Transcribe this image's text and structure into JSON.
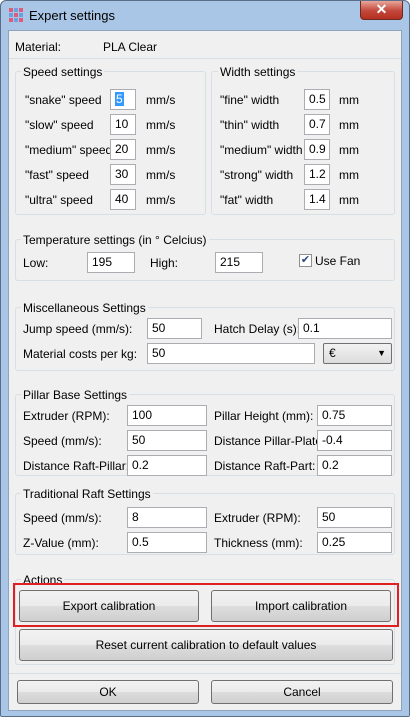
{
  "window": {
    "title": "Expert settings",
    "close_label": "✕"
  },
  "material": {
    "label": "Material:",
    "value": "PLA Clear"
  },
  "speed": {
    "title": "Speed settings",
    "rows": [
      {
        "label": "\"snake\" speed",
        "value": "5",
        "unit": "mm/s"
      },
      {
        "label": "\"slow\" speed",
        "value": "10",
        "unit": "mm/s"
      },
      {
        "label": "\"medium\" speed",
        "value": "20",
        "unit": "mm/s"
      },
      {
        "label": "\"fast\" speed",
        "value": "30",
        "unit": "mm/s"
      },
      {
        "label": "\"ultra\" speed",
        "value": "40",
        "unit": "mm/s"
      }
    ]
  },
  "width": {
    "title": "Width settings",
    "rows": [
      {
        "label": "\"fine\" width",
        "value": "0.5",
        "unit": "mm"
      },
      {
        "label": "\"thin\" width",
        "value": "0.7",
        "unit": "mm"
      },
      {
        "label": "\"medium\" width",
        "value": "0.9",
        "unit": "mm"
      },
      {
        "label": "\"strong\" width",
        "value": "1.2",
        "unit": "mm"
      },
      {
        "label": "\"fat\" width",
        "value": "1.4",
        "unit": "mm"
      }
    ]
  },
  "temperature": {
    "title": "Temperature settings (in ° Celcius)",
    "low_label": "Low:",
    "low_value": "195",
    "high_label": "High:",
    "high_value": "215",
    "fan_label": "Use Fan",
    "fan_checked": true
  },
  "misc": {
    "title": "Miscellaneous Settings",
    "jump_label": "Jump speed (mm/s):",
    "jump_value": "50",
    "hatch_label": "Hatch Delay (s):",
    "hatch_value": "0.1",
    "cost_label": "Material costs per kg:",
    "cost_value": "50",
    "currency": "€"
  },
  "pillar": {
    "title": "Pillar Base Settings",
    "extruder_label": "Extruder (RPM):",
    "extruder_value": "100",
    "height_label": "Pillar Height (mm):",
    "height_value": "0.75",
    "speed_label": "Speed (mm/s):",
    "speed_value": "50",
    "dist_plate_label": "Distance Pillar-Plate:",
    "dist_plate_value": "-0.4",
    "dist_raft_label": "Distance Raft-Pillar:",
    "dist_raft_value": "0.2",
    "dist_part_label": "Distance Raft-Part:",
    "dist_part_value": "0.2"
  },
  "raft": {
    "title": "Traditional Raft Settings",
    "speed_label": "Speed (mm/s):",
    "speed_value": "8",
    "extruder_label": "Extruder (RPM):",
    "extruder_value": "50",
    "z_label": "Z-Value (mm):",
    "z_value": "0.5",
    "thickness_label": "Thickness (mm):",
    "thickness_value": "0.25"
  },
  "actions": {
    "title": "Actions",
    "export_label": "Export calibration",
    "import_label": "Import calibration",
    "reset_label": "Reset current calibration to default values"
  },
  "footer": {
    "ok_label": "OK",
    "cancel_label": "Cancel"
  },
  "colors": {
    "highlight": "#e02020",
    "selection": "#3399ff"
  }
}
